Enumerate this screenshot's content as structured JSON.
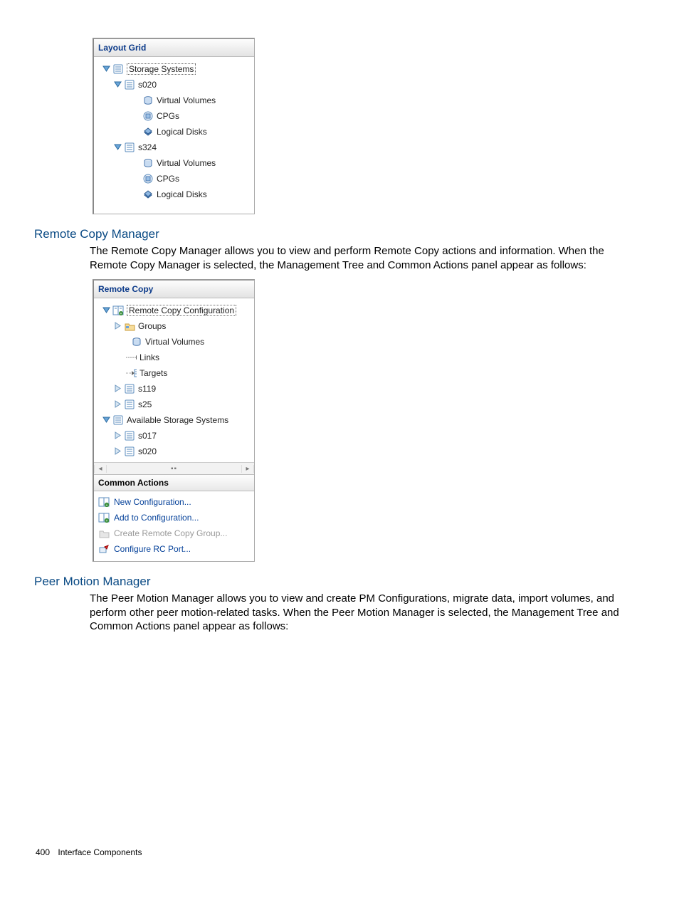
{
  "layout_grid": {
    "title": "Layout Grid",
    "root": "Storage Systems",
    "systems": [
      {
        "name": "s020",
        "children": [
          "Virtual Volumes",
          "CPGs",
          "Logical Disks"
        ]
      },
      {
        "name": "s324",
        "children": [
          "Virtual Volumes",
          "CPGs",
          "Logical Disks"
        ]
      }
    ]
  },
  "section_rcm": {
    "heading": "Remote Copy Manager",
    "para": "The Remote Copy Manager allows you to view and perform Remote Copy actions and information. When the Remote Copy Manager is selected, the Management Tree and Common Actions panel appear as follows:"
  },
  "remote_copy": {
    "title": "Remote Copy",
    "root": "Remote Copy Configuration",
    "children1": [
      {
        "label": "Groups",
        "icon": "folder",
        "toggle": "collapsed"
      },
      {
        "label": "Virtual Volumes",
        "icon": "vv",
        "toggle": "none-indent"
      },
      {
        "label": "Links",
        "icon": "links",
        "toggle": "none"
      },
      {
        "label": "Targets",
        "icon": "targets",
        "toggle": "none"
      },
      {
        "label": "s119",
        "icon": "storage",
        "toggle": "collapsed"
      },
      {
        "label": "s25",
        "icon": "storage",
        "toggle": "collapsed"
      }
    ],
    "avail": {
      "label": "Available Storage Systems",
      "children": [
        "s017",
        "s020"
      ]
    },
    "common_title": "Common Actions",
    "actions_label": {
      "new": "New Configuration...",
      "add": "Add to Configuration...",
      "create": "Create Remote Copy Group...",
      "port": "Configure RC Port..."
    }
  },
  "section_pmm": {
    "heading": "Peer Motion Manager",
    "para": "The Peer Motion Manager allows you to view and create PM Configurations, migrate data, import volumes, and perform other peer motion-related tasks. When the Peer Motion Manager is selected, the Management Tree and Common Actions panel appear as follows:"
  },
  "footer": {
    "page_no": "400",
    "label": "Interface Components"
  }
}
